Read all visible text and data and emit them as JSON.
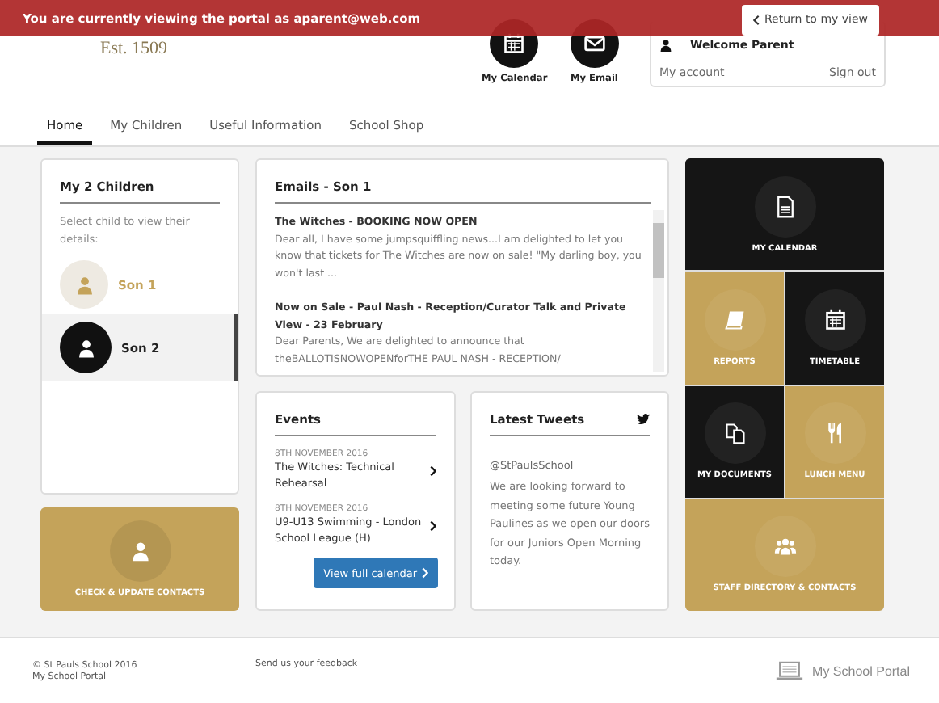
{
  "banner": {
    "text": "You are currently viewing the portal as aparent@web.com",
    "button": "Return to my view"
  },
  "logo": {
    "est": "Est. 1509"
  },
  "header_links": [
    {
      "kind": "calendar",
      "label": "My Calendar"
    },
    {
      "kind": "email",
      "label": "My Email"
    }
  ],
  "account": {
    "welcome": "Welcome Parent",
    "my_account": "My account",
    "sign_out": "Sign out"
  },
  "nav": [
    {
      "label": "Home",
      "selected": true
    },
    {
      "label": "My Children",
      "selected": false
    },
    {
      "label": "Useful Information",
      "selected": false
    },
    {
      "label": "School Shop",
      "selected": false
    }
  ],
  "children_card": {
    "title": "My 2 Children",
    "hint": "Select child to view their details:",
    "children": [
      {
        "name": "Son 1",
        "selected": false
      },
      {
        "name": "Son 2",
        "selected": true
      }
    ]
  },
  "contacts_tile": {
    "label": "CHECK & UPDATE CONTACTS"
  },
  "emails": {
    "title": "Emails - Son 1",
    "items": [
      {
        "subject": "The Witches - BOOKING NOW OPEN",
        "preview": "Dear all, I have some jumpsquiffling news...I am delighted to let you know that tickets for The Witches are now on sale! \"My darling boy, you won't last ..."
      },
      {
        "subject": "Now on Sale - Paul Nash - Reception/Curator Talk and Private View - 23 February",
        "preview": "Dear Parents, We are delighted to announce that theBALLOTISNOWOPENforTHE PAUL NASH - RECEPTION/"
      }
    ]
  },
  "events": {
    "title": "Events",
    "items": [
      {
        "date": "8TH NOVEMBER 2016",
        "title": "The Witches: Technical Rehearsal"
      },
      {
        "date": "8TH NOVEMBER 2016",
        "title": "U9-U13 Swimming - London School League (H)"
      }
    ],
    "button": "View full calendar"
  },
  "tweets": {
    "title": "Latest Tweets",
    "handle": "@StPaulsSchool",
    "text": "We are looking forward to meeting some future Young Paulines as we open our doors for our Juniors Open Morning today."
  },
  "tiles": [
    {
      "kind": "document",
      "label": "MY CALENDAR",
      "wide": true,
      "color": "#151515"
    },
    {
      "kind": "book",
      "label": "REPORTS",
      "wide": false,
      "color": "#c4a35a"
    },
    {
      "kind": "calendar",
      "label": "TIMETABLE",
      "wide": false,
      "color": "#151515"
    },
    {
      "kind": "documents",
      "label": "MY DOCUMENTS",
      "wide": false,
      "color": "#151515"
    },
    {
      "kind": "cutlery",
      "label": "LUNCH MENU",
      "wide": false,
      "color": "#c4a35a"
    },
    {
      "kind": "people",
      "label": "STAFF DIRECTORY & CONTACTS",
      "wide": true,
      "color": "#c4a35a"
    }
  ],
  "footer": {
    "copyright": "© St Pauls School 2016",
    "portal_line": "My School Portal",
    "feedback": "Send us your feedback",
    "brand": "My School Portal"
  }
}
